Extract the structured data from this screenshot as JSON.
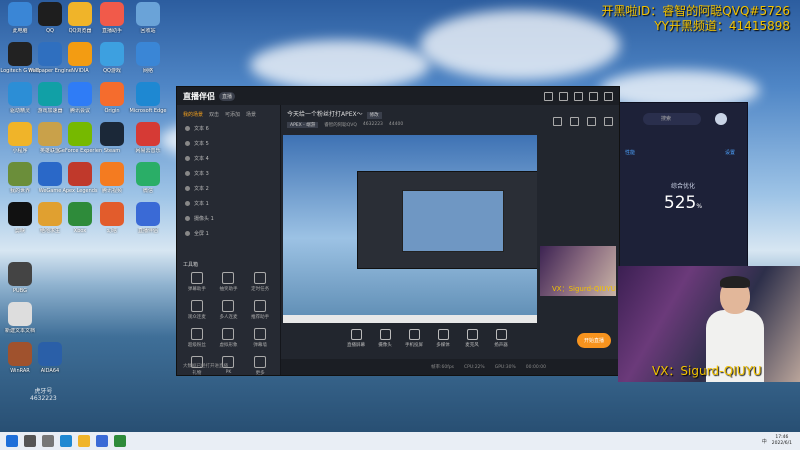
{
  "overlay": {
    "line1": "开黑啦ID：睿智的阿聪QVQ#5726",
    "line2": "YY开黑频道：41415898"
  },
  "desktop_icons": [
    {
      "label": "此电脑",
      "color": "#3a86d6"
    },
    {
      "label": "QQ",
      "color": "#1e1e1e"
    },
    {
      "label": "QQ浏览器",
      "color": "#f0b429"
    },
    {
      "label": "直播助手",
      "color": "#f15a4a"
    },
    {
      "label": "回收站",
      "color": "#6aa3d8"
    },
    {
      "label": "Logitech G HUB",
      "color": "#222"
    },
    {
      "label": "Wallpaper Engine",
      "color": "#2f6fbf"
    },
    {
      "label": "NVIDIA",
      "color": "#f39c12"
    },
    {
      "label": "QQ游戏",
      "color": "#3da0e0"
    },
    {
      "label": "网络",
      "color": "#3a86d6"
    },
    {
      "label": "驱动精灵",
      "color": "#2c8ed6"
    },
    {
      "label": "游戏加速器",
      "color": "#11a0a6"
    },
    {
      "label": "腾讯会议",
      "color": "#2f7cf6"
    },
    {
      "label": "Origin",
      "color": "#f56c2d"
    },
    {
      "label": "Microsoft Edge",
      "color": "#1e88d2"
    },
    {
      "label": "小程序",
      "color": "#f0b429"
    },
    {
      "label": "英雄联盟",
      "color": "#c9a14a"
    },
    {
      "label": "GeForce Experience",
      "color": "#76b900"
    },
    {
      "label": "Steam",
      "color": "#1b2838"
    },
    {
      "label": "网易云音乐",
      "color": "#d63a35"
    },
    {
      "label": "我的世界",
      "color": "#6b8e3a"
    },
    {
      "label": "WeGame",
      "color": "#2a68c8"
    },
    {
      "label": "Apex Legends",
      "color": "#c0392b"
    },
    {
      "label": "腾讯视频",
      "color": "#f47b20"
    },
    {
      "label": "微信",
      "color": "#2aae67"
    },
    {
      "label": "剪映",
      "color": "#111"
    },
    {
      "label": "绝地求生",
      "color": "#e0a030"
    },
    {
      "label": "Xbox",
      "color": "#2e8b3a"
    },
    {
      "label": "幻塔",
      "color": "#e25c2c"
    },
    {
      "label": "直播伴侣",
      "color": "#3a6ad6"
    },
    {
      "label": "PUBG",
      "color": "#444"
    },
    {
      "label": "新建文本文档",
      "color": "#ddd"
    },
    {
      "label": "WinRAR",
      "color": "#a0522d"
    },
    {
      "label": "AIDA64",
      "color": "#2a5fa8"
    }
  ],
  "main_window": {
    "app_name": "直播伴侣",
    "version": "直播",
    "left_tabs": [
      "我的场景",
      "双击",
      "可添加",
      "场景"
    ],
    "sources": [
      "文本 6",
      "文本 5",
      "文本 4",
      "文本 3",
      "文本 2",
      "文本 1",
      "摄像头 1",
      "全屏 1"
    ],
    "tools_header": "工具箱",
    "tools": [
      "弹幕助手",
      "抽奖助手",
      "定时任务",
      "观众连麦",
      "多人连麦",
      "推荐助手",
      "超级粉丝",
      "虚拟形象",
      "弹幕墙",
      "礼物",
      "PK",
      "更多"
    ],
    "hint": "大数据已经打开进直播",
    "stream_title": "今天给一个粉丝打打APEX～",
    "edit_label": "修改",
    "stream_meta": [
      "APEX - 端游",
      "睿智的阿聪QVQ",
      "4632223",
      "44400"
    ],
    "controls": [
      "直播屏幕",
      "摄像头",
      "手机投屏",
      "多媒体",
      "麦克风",
      "扬声器"
    ],
    "golive": "开始直播",
    "status": [
      "帧率:60fps",
      "CPU:22%",
      "GPU:30%",
      "00:00:00"
    ]
  },
  "right_window": {
    "search_placeholder": "搜索",
    "tab_left": "性能",
    "tab_right": "设置",
    "label": "综合优化",
    "value": "525",
    "unit": "%"
  },
  "camera": {
    "caption": "VX：Sigurd-QIUYU",
    "small_caption": "VX：Sigurd-QIUYU"
  },
  "watermark": {
    "line1": "虎牙号",
    "line2": "4632223"
  },
  "taskbar": {
    "time": "17:46",
    "date": "2022/6/1",
    "lang": "中"
  }
}
